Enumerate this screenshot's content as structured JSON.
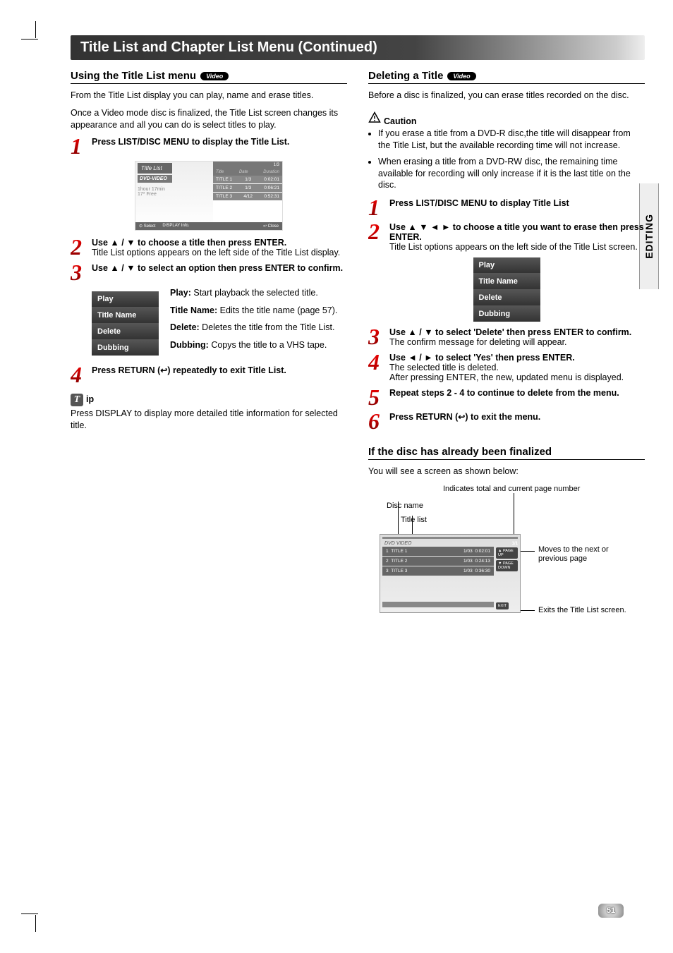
{
  "page_number": "51",
  "side_tab": "EDITING",
  "section_title": "Title List and Chapter List Menu (Continued)",
  "badge_video": "Video",
  "left": {
    "heading": "Using the Title List menu",
    "intro1": "From the Title List display you can play, name and erase titles.",
    "intro2": "Once a Video mode disc is finalized, the Title List screen changes its appearance and all you can do is select titles to play.",
    "step1": "Press LIST/DISC MENU to display the Title List.",
    "step2_bold": "Use ▲ / ▼ to choose a title then press ENTER.",
    "step2_body": "Title List options appears on the left side of the Title List display.",
    "step3": "Use ▲ / ▼ to select an option then press ENTER to confirm.",
    "menu": {
      "play": "Play",
      "title_name": "Title Name",
      "delete": "Delete",
      "dubbing": "Dubbing"
    },
    "desc_play_label": "Play:",
    "desc_play_text": " Start playback the selected title.",
    "desc_titlename_label": "Title Name:",
    "desc_titlename_text": " Edits the title name (page 57).",
    "desc_delete_label": "Delete:",
    "desc_delete_text": " Deletes the title from the Title List.",
    "desc_dubbing_label": "Dubbing:",
    "desc_dubbing_text": " Copys the title to a VHS tape.",
    "step4_a": "Press RETURN (",
    "step4_b": ") repeatedly to exit Title List.",
    "tip_label": "ip",
    "tip_body": "Press DISPLAY to display more detailed title information for selected title.",
    "screenshot": {
      "hdr": "Title List",
      "subhdr": "DVD-VIDEO",
      "free": "1hour 17min\n17* Free",
      "page": "1/3",
      "col_title": "Title",
      "col_date": "Date",
      "col_dur": "Duration",
      "rows": [
        {
          "t": "TITLE 1",
          "d": "1/3",
          "dur": "0:02:01"
        },
        {
          "t": "TITLE 2",
          "d": "1/3",
          "dur": "0:06:21"
        },
        {
          "t": "TITLE 3",
          "d": "4/12",
          "dur": "0:52:31"
        }
      ],
      "f_select": "⊙ Select",
      "f_info": "DISPLAY Info.",
      "f_close": "↩ Close"
    }
  },
  "right": {
    "heading": "Deleting a Title",
    "intro": "Before a disc is finalized, you can erase titles recorded on the disc.",
    "caution_label": "Caution",
    "caution1": "If you erase a title from a DVD-R disc,the title will disappear from the Title List, but the available recording time will not increase.",
    "caution2": "When erasing a title from a DVD-RW disc, the remaining time available for recording will only increase if it is the last title on the disc.",
    "step1": "Press LIST/DISC MENU to display Title List",
    "step2_bold": "Use ▲ ▼ ◄ ► to choose a title you want to erase then press ENTER.",
    "step2_body": "Title List options appears on the left side of the Title List screen.",
    "step3_bold": "Use ▲ / ▼ to select 'Delete' then press ENTER to confirm.",
    "step3_body": "The confirm message for deleting will appear.",
    "step4_bold": "Use ◄ / ► to select 'Yes' then press ENTER.",
    "step4_body1": "The selected title is deleted.",
    "step4_body2": "After pressing ENTER, the new, updated menu is displayed.",
    "step5": "Repeat steps 2 - 4 to continue to delete from the menu.",
    "step6_a": "Press RETURN (",
    "step6_b": ") to exit the menu.",
    "finalized_heading": "If the disc has already been finalized",
    "finalized_intro": "You will see a screen as shown below:",
    "callout_top": "Indicates total and current page number",
    "callout_discname": "Disc name",
    "callout_titlelist": "Title list",
    "callout_move": "Moves to the next or previous page",
    "callout_exit": "Exits the Title List screen.",
    "fs": {
      "dvd": "DVD VIDEO",
      "page": "1/1",
      "rows": [
        {
          "n": "1",
          "t": "TITLE 1",
          "d": "1/03",
          "dur": "0:02:01"
        },
        {
          "n": "2",
          "t": "TITLE 2",
          "d": "1/03",
          "dur": "0:24:13"
        },
        {
          "n": "3",
          "t": "TITLE 3",
          "d": "1/03",
          "dur": "0:36:30"
        }
      ],
      "page_up": "▲ PAGE UP",
      "page_down": "▼ PAGE DOWN",
      "exit": "EXIT"
    }
  }
}
